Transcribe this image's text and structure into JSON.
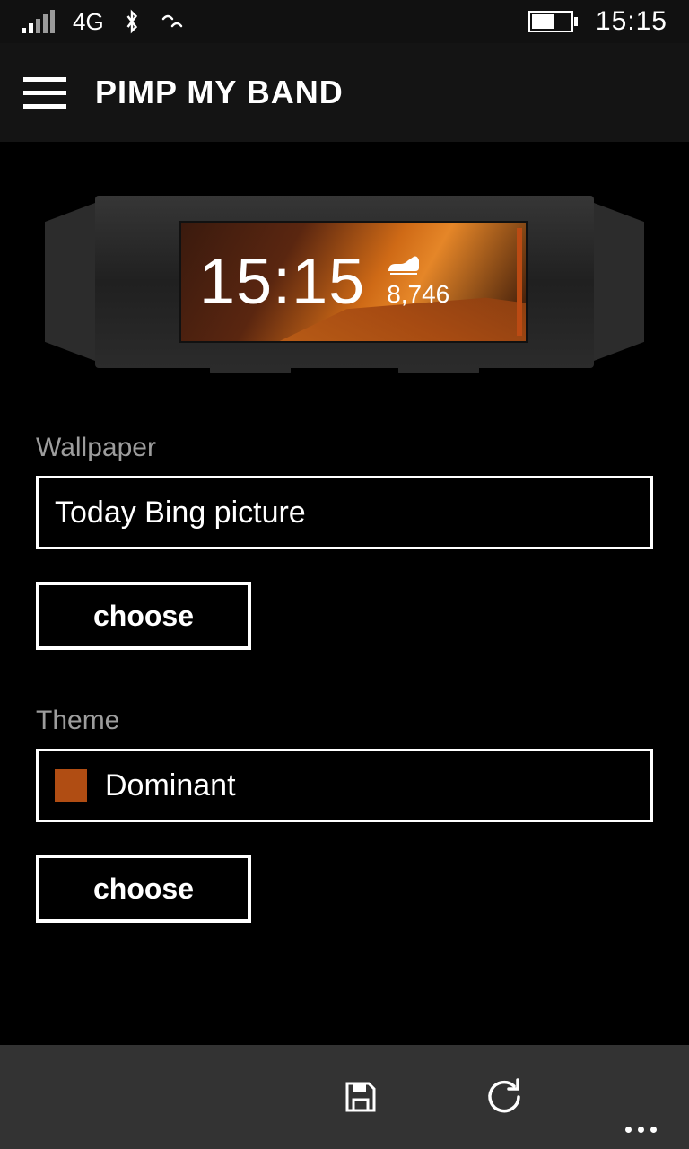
{
  "status": {
    "network": "4G",
    "time": "15:15",
    "battery_percent": 55
  },
  "header": {
    "title": "PIMP MY BAND"
  },
  "band_preview": {
    "time": "15:15",
    "steps": "8,746",
    "accent_color": "#bb4a13"
  },
  "wallpaper": {
    "label": "Wallpaper",
    "selected": "Today Bing picture",
    "choose_label": "choose"
  },
  "theme": {
    "label": "Theme",
    "selected": "Dominant",
    "swatch_color": "#b04d13",
    "choose_label": "choose"
  },
  "appbar": {
    "save_label": "save",
    "sync_label": "sync",
    "more_label": "more"
  }
}
